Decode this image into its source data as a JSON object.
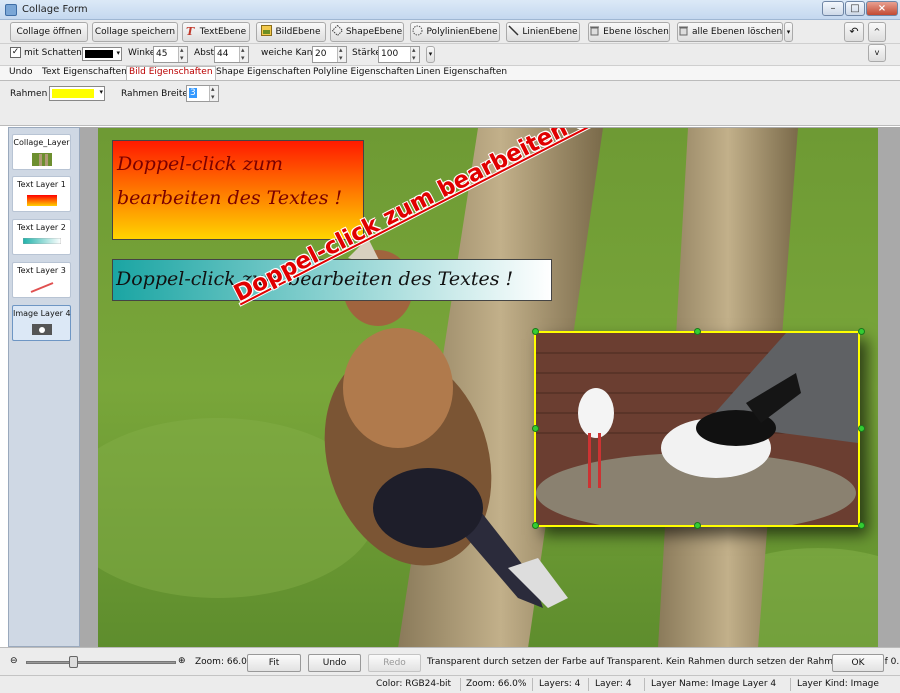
{
  "window": {
    "title": "Collage Form"
  },
  "toolbar": {
    "open_label": "Collage öffnen",
    "save_label": "Collage speichern",
    "text_layer_label": "TextEbene",
    "image_layer_label": "BildEbene",
    "shape_layer_label": "ShapeEbene",
    "polyline_layer_label": "PolylinienEbene",
    "line_layer_label": "LinienEbene",
    "delete_layer_label": "Ebene löschen",
    "delete_all_label": "alle Ebenen löschen"
  },
  "options": {
    "shadow_label": "mit Schatten",
    "shadow_checked": true,
    "shadow_color": "#000000",
    "angle_label": "Winkel",
    "angle_value": "45",
    "distance_label": "Abst",
    "distance_value": "44",
    "soft_edge_label": "weiche Kante",
    "soft_edge_value": "20",
    "strength_label": "Stärke",
    "strength_value": "100"
  },
  "tabs": [
    {
      "label": "Undo",
      "active": false
    },
    {
      "label": "Text Eigenschaften",
      "active": false
    },
    {
      "label": "Bild Eigenschaften",
      "active": true
    },
    {
      "label": "Shape Eigenschaften",
      "active": false
    },
    {
      "label": "Polyline Eigenschaften",
      "active": false
    },
    {
      "label": "Linen Eigenschaften",
      "active": false
    }
  ],
  "properties": {
    "frame_label": "Rahmen",
    "frame_color": "#ffff00",
    "frame_width_label": "Rahmen Breite",
    "frame_width_value": "3"
  },
  "layers": [
    {
      "label": "Collage_Layer",
      "selected": false
    },
    {
      "label": "Text Layer 1",
      "selected": false
    },
    {
      "label": "Text Layer 2",
      "selected": false
    },
    {
      "label": "Text Layer 3",
      "selected": false
    },
    {
      "label": "Image Layer 4",
      "selected": true
    }
  ],
  "canvas": {
    "text1": "Doppel-click zum bearbeiten des Textes !",
    "text2": "Doppel-click zum bearbeiten des Textes !",
    "text3": "Doppel-click zum bearbeiten des Textes !",
    "text1_color": "#7a0000",
    "text3_color": "#e00000",
    "image_frame_color": "#ffff00",
    "handle_color": "#33cc33"
  },
  "bottom": {
    "zoom_label": "Zoom: 66.0%",
    "zoom_value": 0.3,
    "fit_label": "Fit",
    "undo_label": "Undo",
    "redo_label": "Redo",
    "hint": "Transparent durch setzen der Farbe auf Transparent. Kein Rahmen durch setzen der Rahmenbreite auf  0.",
    "ok_label": "OK"
  },
  "status": {
    "color": "Color: RGB24-bit",
    "zoom": "Zoom: 66.0%",
    "layers": "Layers: 4",
    "layer": "Layer: 4",
    "layer_name": "Layer Name: Image Layer 4",
    "layer_kind": "Layer Kind: Image"
  }
}
